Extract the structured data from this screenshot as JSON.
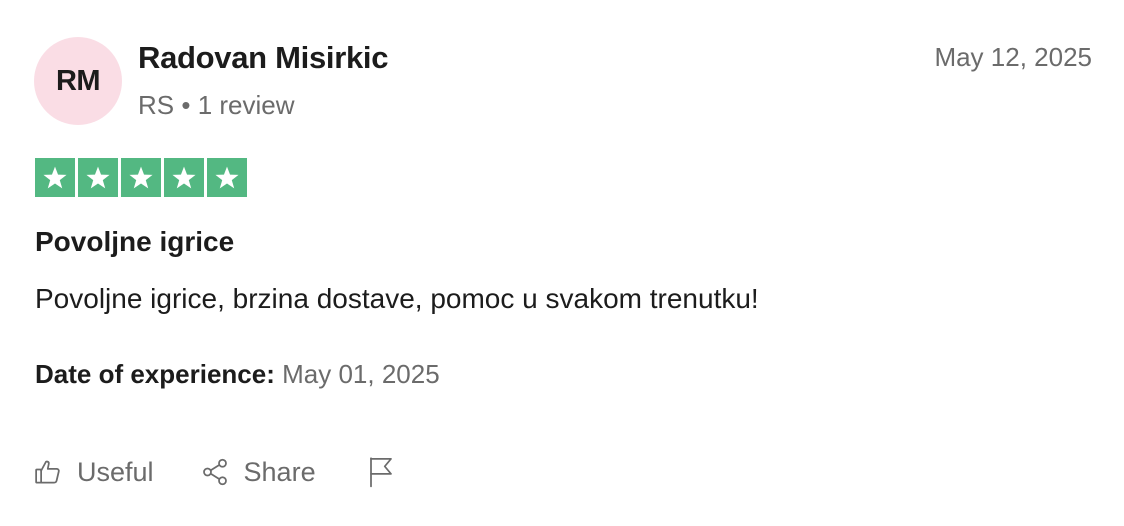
{
  "author": {
    "initials": "RM",
    "name": "Radovan Misirkic",
    "country": "RS",
    "separator": "•",
    "review_count": "1 review"
  },
  "review": {
    "date": "May 12, 2025",
    "rating": 5,
    "rating_max": 5,
    "title": "Povoljne igrice",
    "text": "Povoljne igrice, brzina dostave, pomoc u svakom trenutku!",
    "experience_label": "Date of experience:",
    "experience_date": "May 01, 2025"
  },
  "actions": {
    "useful_label": "Useful",
    "useful_icon": "thumbs-up-icon",
    "share_label": "Share",
    "share_icon": "share-icon",
    "report_icon": "flag-icon"
  },
  "colors": {
    "star_bg": "#53b882",
    "avatar_bg": "#fadde5",
    "muted_text": "#6b6b6b"
  }
}
